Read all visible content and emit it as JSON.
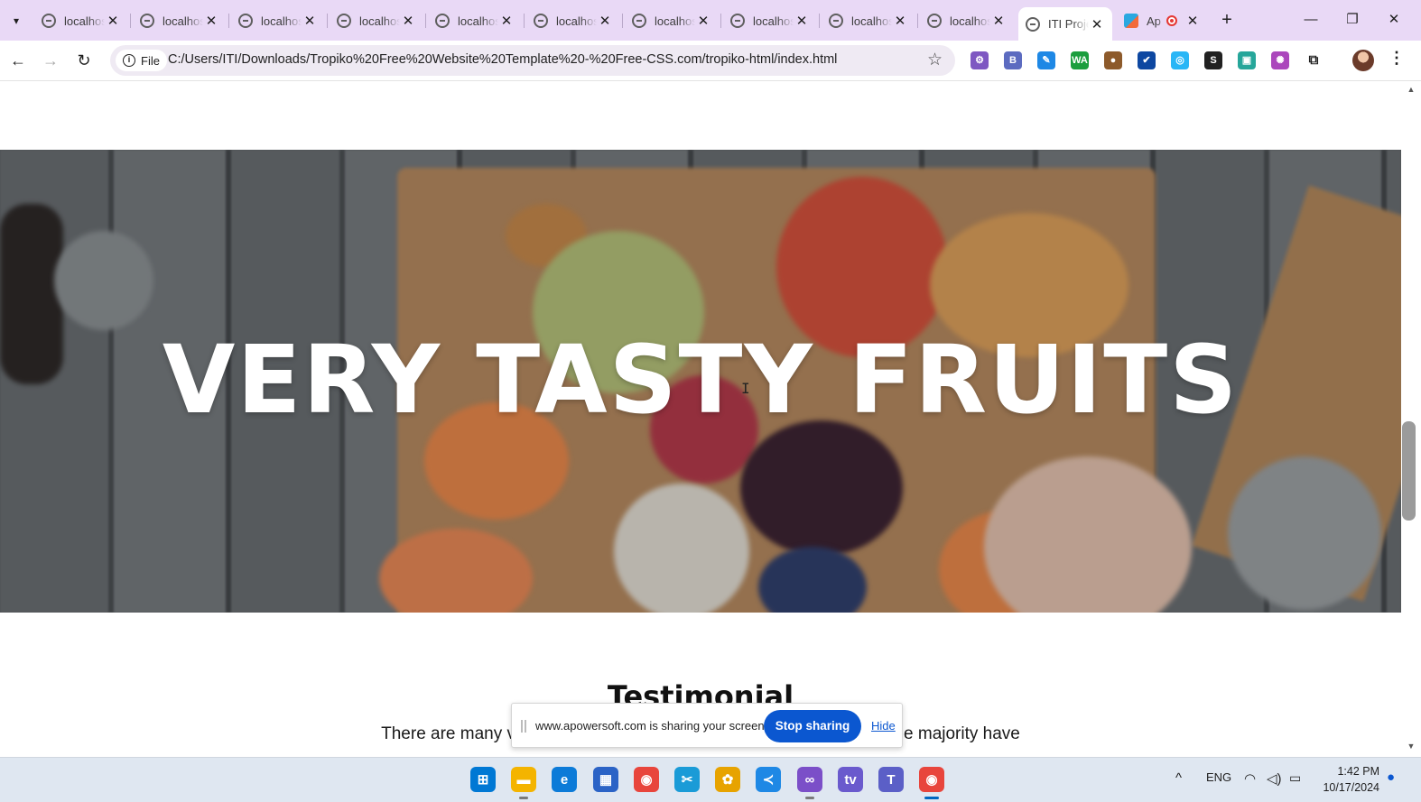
{
  "browser": {
    "tabs": [
      {
        "title": "localhost",
        "active": false
      },
      {
        "title": "localhost",
        "active": false
      },
      {
        "title": "localhost",
        "active": false
      },
      {
        "title": "localhost",
        "active": false
      },
      {
        "title": "localhost",
        "active": false
      },
      {
        "title": "localhost",
        "active": false
      },
      {
        "title": "localhost",
        "active": false
      },
      {
        "title": "localhost",
        "active": false
      },
      {
        "title": "localhost",
        "active": false
      },
      {
        "title": "localhost",
        "active": false
      },
      {
        "title": "ITI Project",
        "active": true
      },
      {
        "title": "Ap",
        "active": false,
        "recording": true
      }
    ],
    "new_tab": "+",
    "window_controls": {
      "minimize": "—",
      "restore": "❐",
      "close": "✕"
    },
    "toolbar": {
      "back": "←",
      "forward": "→",
      "reload": "↻",
      "scheme_chip": "File",
      "url": "C:/Users/ITI/Downloads/Tropiko%20Free%20Website%20Template%20-%20Free-CSS.com/tropiko-html/index.html",
      "bookmark": "☆",
      "extensions": [
        {
          "name": "gear-extension-icon",
          "glyph": "⚙",
          "color": "#7e57c2"
        },
        {
          "name": "b-extension-icon",
          "glyph": "B",
          "color": "#5c6bc0"
        },
        {
          "name": "pen-extension-icon",
          "glyph": "✎",
          "color": "#1e88e5"
        },
        {
          "name": "wa-extension-icon",
          "glyph": "WA",
          "color": "#1b9e3e"
        },
        {
          "name": "cookie-extension-icon",
          "glyph": "●",
          "color": "#8d5a2b"
        },
        {
          "name": "check-extension-icon",
          "glyph": "✔",
          "color": "#0d47a1"
        },
        {
          "name": "circle-extension-icon",
          "glyph": "◎",
          "color": "#29b6f6"
        },
        {
          "name": "s-extension-icon",
          "glyph": "S",
          "color": "#212121"
        },
        {
          "name": "screen-extension-icon",
          "glyph": "▣",
          "color": "#26a69a"
        },
        {
          "name": "brain-extension-icon",
          "glyph": "✺",
          "color": "#ab47bc"
        },
        {
          "name": "puzzle-extension-icon",
          "glyph": "⧉",
          "color": "#ffffff"
        }
      ],
      "menu": "⋮"
    }
  },
  "page": {
    "hero_title": "VERY TASTY FRUITS",
    "testimonial_title": "Testimonial",
    "testimonial_text_left": "There are many v",
    "testimonial_text_right": "e majority have"
  },
  "share_bar": {
    "message": "www.apowersoft.com is sharing your screen.",
    "stop_label": "Stop sharing",
    "hide_label": "Hide"
  },
  "taskbar": {
    "apps": [
      {
        "name": "windows-start-icon",
        "glyph": "⊞",
        "color": "#0078d4"
      },
      {
        "name": "file-explorer-icon",
        "glyph": "▬",
        "color": "#f4b400"
      },
      {
        "name": "edge-icon",
        "glyph": "e",
        "color": "#0c7bd8"
      },
      {
        "name": "store-icon",
        "glyph": "▦",
        "color": "#2b63c6"
      },
      {
        "name": "chrome-icon",
        "glyph": "◉",
        "color": "#e8453c"
      },
      {
        "name": "snipping-icon",
        "glyph": "✂",
        "color": "#1a9bd7"
      },
      {
        "name": "photos-icon",
        "glyph": "✿",
        "color": "#e7a300"
      },
      {
        "name": "vscode-icon",
        "glyph": "≺",
        "color": "#1e88e5"
      },
      {
        "name": "visual-studio-icon",
        "glyph": "∞",
        "color": "#7b4fc8"
      },
      {
        "name": "iptv-icon",
        "glyph": "tv",
        "color": "#6a5acd"
      },
      {
        "name": "teams-icon",
        "glyph": "T",
        "color": "#5b5fc7"
      },
      {
        "name": "chrome-active-icon",
        "glyph": "◉",
        "color": "#e8453c"
      }
    ],
    "tray": {
      "chevron": "^",
      "language": "ENG",
      "wifi": "wifi",
      "volume": "vol",
      "battery": "bat"
    },
    "time": "1:42 PM",
    "date": "10/17/2024",
    "notification": "🔔"
  }
}
